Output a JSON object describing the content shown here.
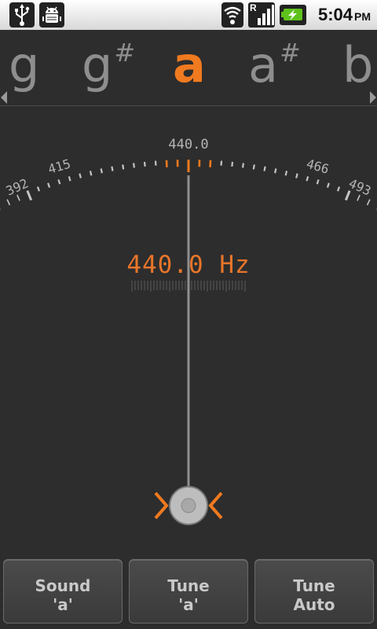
{
  "status_bar": {
    "time": "5:04",
    "ampm": "PM",
    "icons": [
      "usb-icon",
      "android-debug-icon",
      "wifi-icon",
      "signal-roaming-icon",
      "battery-charging-icon"
    ],
    "roaming_label": "R"
  },
  "notes": {
    "items": [
      {
        "letter": "g",
        "sharp": "",
        "active": false
      },
      {
        "letter": "g",
        "sharp": "#",
        "active": false
      },
      {
        "letter": "a",
        "sharp": "",
        "active": true
      },
      {
        "letter": "a",
        "sharp": "#",
        "active": false
      },
      {
        "letter": "b",
        "sharp": "",
        "active": false
      }
    ]
  },
  "gauge": {
    "center_label": "440.0",
    "scale_labels": [
      "392",
      "415",
      "466",
      "493"
    ],
    "needle_value_hz": 440.0,
    "frequency_readout": "440.0 Hz"
  },
  "buttons": [
    {
      "line1": "Sound",
      "line2": "'a'"
    },
    {
      "line1": "Tune",
      "line2": "'a'"
    },
    {
      "line1": "Tune",
      "line2": "Auto"
    }
  ],
  "colors": {
    "accent": "#f07a1f",
    "background": "#2d2d2d",
    "inactive_note": "#8e8e8e",
    "tick": "#c4c4c4"
  }
}
